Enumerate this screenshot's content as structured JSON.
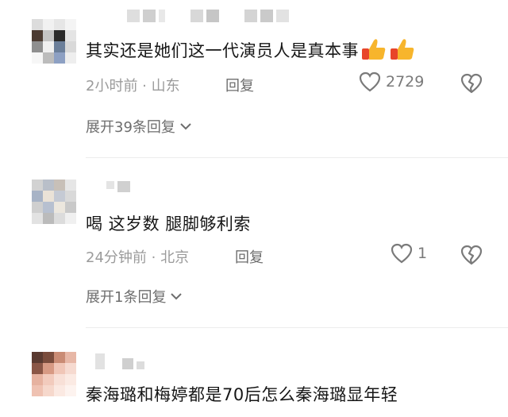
{
  "comments": [
    {
      "text": "其实还是她们这一代演员人是真本事",
      "emoji": [
        "thumbs-up",
        "thumbs-up"
      ],
      "time": "2小时前 · 山东",
      "reply_label": "回复",
      "likes": "2729",
      "expand_label": "展开39条回复"
    },
    {
      "text": "喝 这岁数 腿脚够利索",
      "time": "24分钟前 · 北京",
      "reply_label": "回复",
      "likes": "1",
      "expand_label": "展开1条回复"
    },
    {
      "text": "秦海璐和梅婷都是70后怎么秦海璐显年轻"
    }
  ],
  "colors": {
    "text": "#161616",
    "meta": "#9b9b9b",
    "action": "#6d6d6d",
    "thumb": "#f7b52c",
    "cuff": "#e8452a"
  }
}
